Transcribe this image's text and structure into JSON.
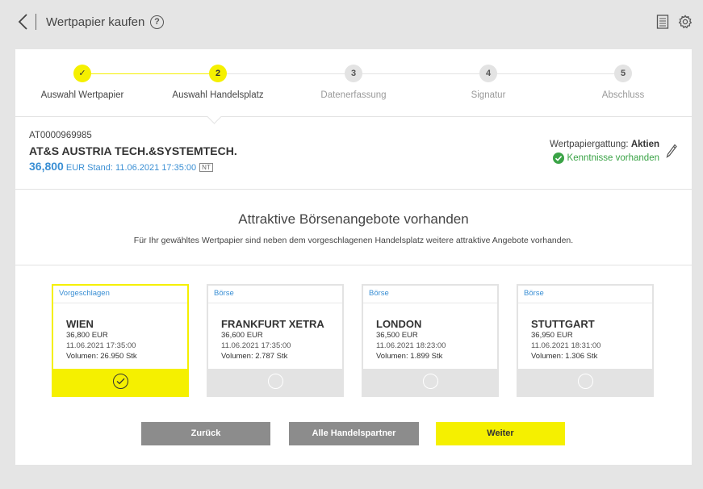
{
  "header": {
    "title": "Wertpapier kaufen",
    "help_icon": "?",
    "icons": [
      "back-icon",
      "help-icon",
      "document-icon",
      "gear-icon"
    ]
  },
  "stepper": {
    "steps": [
      {
        "number": "✓",
        "label": "Auswahl Wertpapier",
        "state": "done"
      },
      {
        "number": "2",
        "label": "Auswahl Handelsplatz",
        "state": "active"
      },
      {
        "number": "3",
        "label": "Datenerfassung",
        "state": "inactive"
      },
      {
        "number": "4",
        "label": "Signatur",
        "state": "inactive"
      },
      {
        "number": "5",
        "label": "Abschluss",
        "state": "inactive"
      }
    ]
  },
  "security": {
    "isin": "AT0000969985",
    "name": "AT&S AUSTRIA TECH.&SYSTEMTECH.",
    "price": "36,800",
    "price_suffix": " EUR Stand: 11.06.2021 17:35:00",
    "badge": "NT",
    "gattung_label": "Wertpapiergattung:",
    "gattung_value": "Aktien",
    "kenntnisse": "Kenntnisse vorhanden"
  },
  "offers": {
    "heading": "Attraktive Börsenangebote vorhanden",
    "subheading": "Für Ihr gewähltes Wertpapier sind neben dem vorgeschlagenen Handelsplatz weitere attraktive Angebote vorhanden.",
    "cards": [
      {
        "tag": "Vorgeschlagen",
        "name": "WIEN",
        "price": "36,800 EUR",
        "date": "11.06.2021 17:35:00",
        "volume": "Volumen: 26.950 Stk",
        "selected": true
      },
      {
        "tag": "Börse",
        "name": "FRANKFURT XETRA",
        "price": "36,600 EUR",
        "date": "11.06.2021 17:35:00",
        "volume": "Volumen: 2.787 Stk",
        "selected": false
      },
      {
        "tag": "Börse",
        "name": "LONDON",
        "price": "36,500 EUR",
        "date": "11.06.2021 18:23:00",
        "volume": "Volumen: 1.899 Stk",
        "selected": false
      },
      {
        "tag": "Börse",
        "name": "STUTTGART",
        "price": "36,950 EUR",
        "date": "11.06.2021 18:31:00",
        "volume": "Volumen: 1.306 Stk",
        "selected": false
      }
    ]
  },
  "buttons": {
    "back": "Zurück",
    "all_partners": "Alle Handelspartner",
    "next": "Weiter"
  },
  "colors": {
    "accent_yellow": "#f5f000",
    "link_blue": "#3a8fd4",
    "success_green": "#3aa346",
    "button_gray": "#8c8c8c"
  }
}
